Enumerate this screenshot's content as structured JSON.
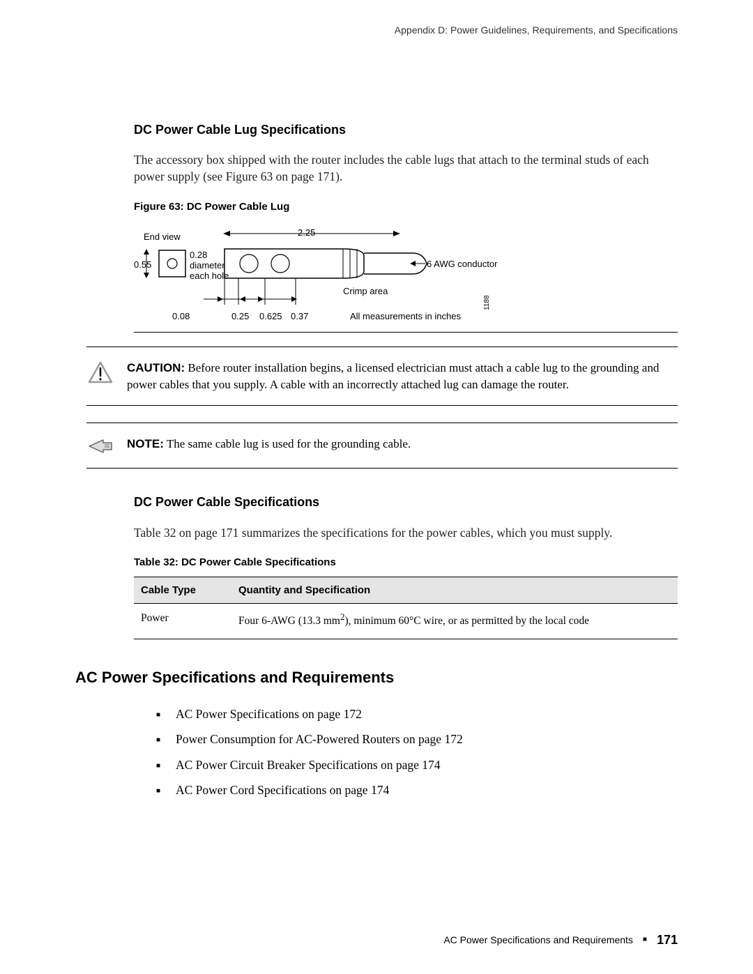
{
  "running_head": "Appendix D: Power Guidelines, Requirements, and Specifications",
  "section1": {
    "title": "DC Power Cable Lug Specifications",
    "intro": "The accessory box shipped with the router includes the cable lugs that attach to the terminal studs of each power supply (see Figure 63 on page 171).",
    "figure_caption": "Figure 63: DC Power Cable Lug"
  },
  "figure63": {
    "end_view": "End view",
    "height": "0.55",
    "hole_dia1": "0.28",
    "hole_dia2": "diameter",
    "hole_dia3": "each hole",
    "top_dim": "2.25",
    "conductor": "6 AWG conductor",
    "crimp": "Crimp area",
    "d1": "0.08",
    "d2": "0.25",
    "d3": "0.625",
    "d4": "0.37",
    "units": "All measurements in inches",
    "id": "1188"
  },
  "caution": {
    "label": "CAUTION:",
    "text": " Before router installation begins, a licensed electrician must attach a cable lug to the grounding and power cables that you supply. A cable with an incorrectly attached lug can damage the router."
  },
  "note": {
    "label": "NOTE:",
    "text": " The same cable lug is used for the grounding cable."
  },
  "section2": {
    "title": "DC Power Cable Specifications",
    "intro": "Table 32 on page 171 summarizes the specifications for the power cables, which you must supply.",
    "table_caption": "Table 32: DC Power Cable Specifications",
    "table": {
      "h1": "Cable Type",
      "h2": "Quantity and Specification",
      "r1c1": "Power",
      "r1c2a": "Four 6-AWG (13.3 mm",
      "r1c2sup": "2",
      "r1c2b": "), minimum 60°C wire, or as permitted by the local code"
    }
  },
  "section3": {
    "title": "AC Power Specifications and Requirements",
    "items": [
      "AC Power Specifications on page 172",
      "Power Consumption for AC-Powered Routers on page 172",
      "AC Power Circuit Breaker Specifications on page 174",
      "AC Power Cord Specifications on page 174"
    ]
  },
  "footer": {
    "text": "AC Power Specifications and Requirements",
    "page": "171"
  }
}
